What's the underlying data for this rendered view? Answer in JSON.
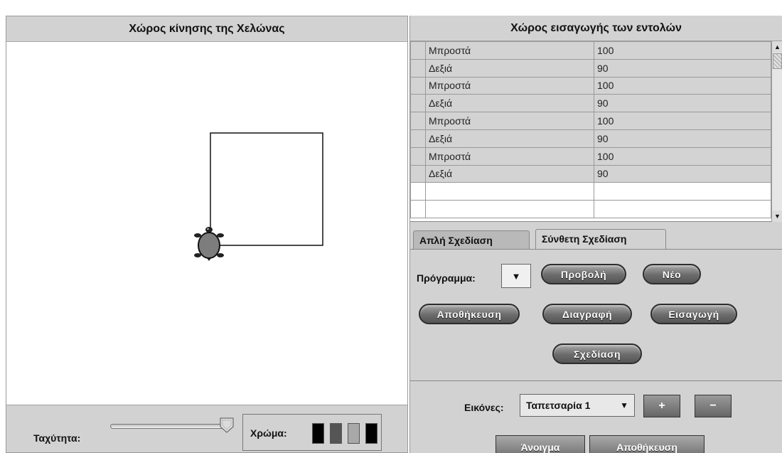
{
  "left_panel": {
    "title": "Χώρος κίνησης της Χελώνας",
    "speed_label": "Ταχύτητα:",
    "speed_level": 0.95,
    "color_label": "Χρώμα:",
    "swatches": [
      "#000000",
      "#555555",
      "#a8a8a8",
      "#000000"
    ]
  },
  "right_panel": {
    "title": "Χώρος εισαγωγής των εντολών",
    "commands": [
      {
        "cmd": "Μπροστά",
        "value": "100"
      },
      {
        "cmd": "Δεξιά",
        "value": "90"
      },
      {
        "cmd": "Μπροστά",
        "value": "100"
      },
      {
        "cmd": "Δεξιά",
        "value": "90"
      },
      {
        "cmd": "Μπροστά",
        "value": "100"
      },
      {
        "cmd": "Δεξιά",
        "value": "90"
      },
      {
        "cmd": "Μπροστά",
        "value": "100"
      },
      {
        "cmd": "Δεξιά",
        "value": "90"
      }
    ],
    "tabs": {
      "simple": "Απλή Σχεδίαση",
      "compound": "Σύνθετη Σχεδίαση"
    },
    "program_label": "Πρόγραμμα:",
    "buttons": {
      "view": "Προβολή",
      "new": "Νέο",
      "save": "Αποθήκευση",
      "delete": "Διαγραφή",
      "import": "Εισαγωγή",
      "draw": "Σχεδίαση"
    },
    "images_label": "Εικόνες:",
    "images_selected": "Ταπετσαρία 1",
    "plus": "+",
    "minus": "−",
    "open": "Άνοιγμα",
    "save2": "Αποθήκευση"
  },
  "icons": [
    "turtle-icon",
    "slider-thumb-icon",
    "scroll-up-icon",
    "scroll-down-icon",
    "dropdown-arrow-icon"
  ],
  "colors": {
    "panel_gray": "#d2d2d2",
    "button_dark": "#5e5e5e"
  }
}
